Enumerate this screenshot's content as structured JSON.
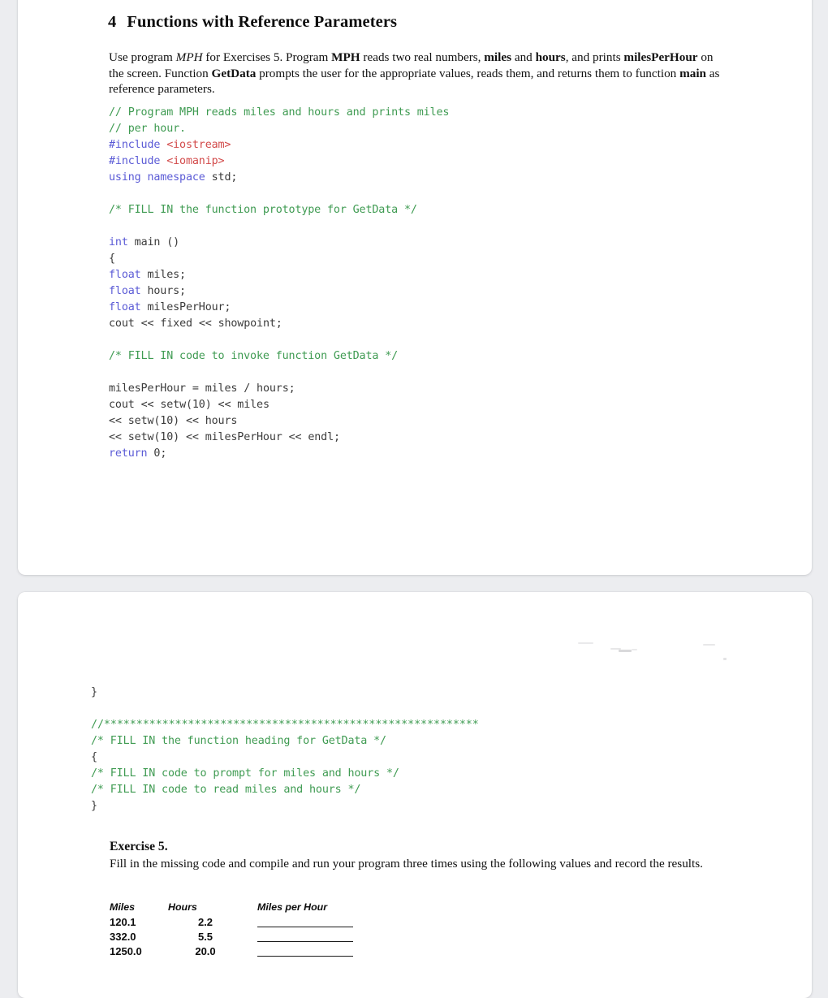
{
  "document": {
    "heading": {
      "number": "4",
      "title": "Functions with Reference Parameters"
    },
    "intro_paragraph": {
      "part1": "Use program ",
      "program_italic": "MPH",
      "part2": " for Exercises 5. Program ",
      "program_bold": "MPH",
      "part3": " reads two real numbers, ",
      "var_miles": "miles",
      "part4": " and ",
      "var_hours": "hours",
      "part5": ", and prints ",
      "var_mph": "milesPerHour",
      "part6": " on the screen. Function ",
      "func_getdata": "GetData",
      "part7": " prompts the user for the appropriate values, reads them, and returns them to function ",
      "func_main": "main",
      "part8": " as reference parameters."
    },
    "code_main": {
      "lines": [
        "// Program MPH reads miles and hours and prints miles",
        "// per hour.",
        "#include <iostream>",
        "#include <iomanip>",
        "using namespace std;",
        "",
        "/* FILL IN the function prototype for GetData */",
        "",
        "int main ()",
        "{",
        "float miles;",
        "float hours;",
        "float milesPerHour;",
        "cout << fixed << showpoint;",
        "",
        "/* FILL IN code to invoke function GetData */",
        "",
        "milesPerHour = miles / hours;",
        "cout << setw(10) << miles",
        "<< setw(10) << hours",
        "<< setw(10) << milesPerHour << endl;",
        "return 0;"
      ]
    },
    "code_tail": {
      "lines": [
        "}",
        "",
        "//**********************************************************",
        "/* FILL IN the function heading for GetData */",
        "{",
        "/* FILL IN code to prompt for miles and hours */",
        "/* FILL IN code to read miles and hours */",
        "}"
      ]
    },
    "exercise": {
      "title": "Exercise 5.",
      "body": "Fill in the missing code and compile and run your program three times using the following values and record the results."
    },
    "results_table": {
      "headers": [
        "Miles",
        "Hours",
        "Miles per Hour"
      ],
      "rows": [
        {
          "miles": "120.1",
          "hours": "2.2",
          "mph": ""
        },
        {
          "miles": "332.0",
          "hours": "5.5",
          "mph": ""
        },
        {
          "miles": "1250.0",
          "hours": "20.0",
          "mph": ""
        }
      ]
    },
    "colors": {
      "page_background": "#ecedf0",
      "card_background": "#ffffff",
      "comment_green": "#3f9b52",
      "keyword_blue": "#5b5bd6",
      "header_red": "#d24a4a",
      "code_plain": "#3b3b3b",
      "body_text": "#111111"
    }
  }
}
